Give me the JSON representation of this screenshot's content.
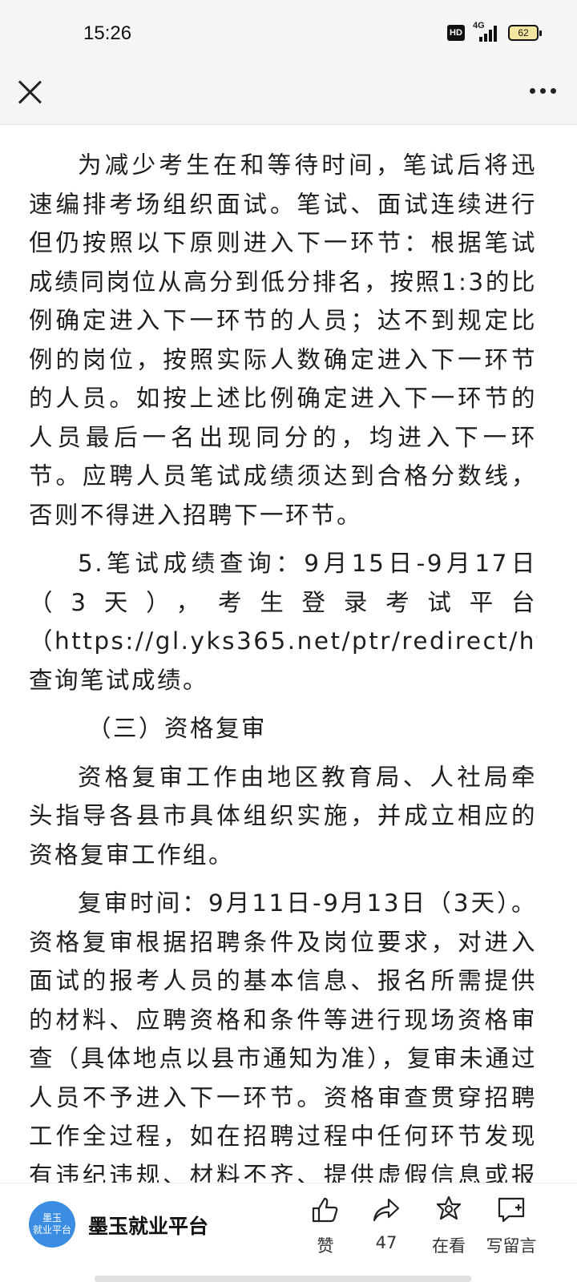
{
  "status_bar": {
    "time": "15:26",
    "hd_label": "HD",
    "network_label": "4G",
    "battery_level": "62"
  },
  "article": {
    "paragraphs": [
      "为减少考生在和等待时间，笔试后将迅速编排考场组织面试。笔试、面试连续进行但仍按照以下原则进入下一环节：根据笔试成绩同岗位从高分到低分排名，按照1:3的比例确定进入下一环节的人员；达不到规定比例的岗位，按照实际人数确定进入下一环节的人员。如按上述比例确定进入下一环节的人员最后一名出现同分的，均进入下一环节。应聘人员笔试成绩须达到合格分数线，否则不得进入招聘下一环节。",
      "5.笔试成绩查询：9月15日-9月17日（3天），考生登录考试平台（https://gl.yks365.net/ptr/redirect/htcj）查询笔试成绩。",
      "（三）资格复审",
      "资格复审工作由地区教育局、人社局牵头指导各县市具体组织实施，并成立相应的资格复审工作组。",
      "复审时间：9月11日-9月13日（3天）。资格复审根据招聘条件及岗位要求，对进入面试的报考人员的基本信息、报名所需提供的材料、应聘资格和条件等进行现场资格审查（具体地点以县市通知为准），复审未通过人员不予进入下一环节。资格审查贯穿招聘工作全过程，如在招聘过程中任何环节发现有违纪违规、材料不齐、提供虚假信息或报考人员条件不符合招聘岗位条件要求等情况的，取消报考"
    ]
  },
  "bottom_bar": {
    "account": {
      "logo_line1": "墨玉",
      "logo_line2": "就业平台",
      "name": "墨玉就业平台"
    },
    "actions": {
      "like": "赞",
      "share": "47",
      "watching": "在看",
      "comment": "写留言"
    }
  },
  "colors": {
    "logo_blue": "#3a8de0",
    "battery_fill": "#f3e6a0",
    "header_bg": "#f5f5f5"
  },
  "icons": [
    "close-icon",
    "more-icon",
    "like-icon",
    "share-icon",
    "watching-icon",
    "comment-icon"
  ]
}
